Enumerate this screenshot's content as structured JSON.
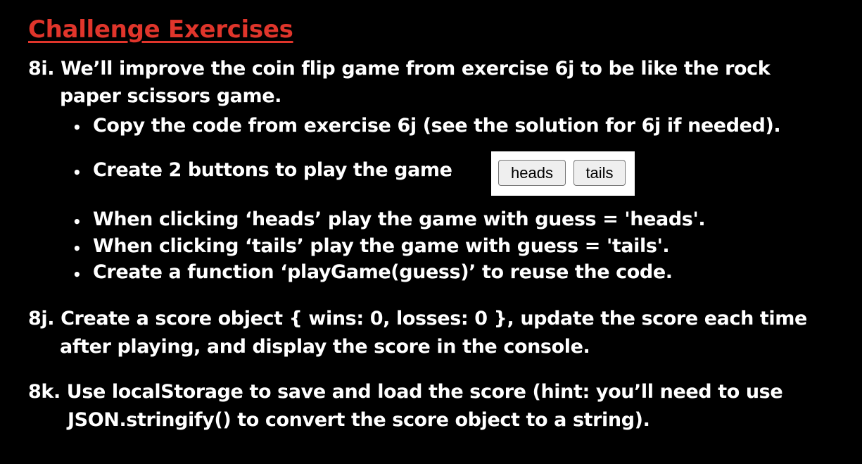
{
  "title": "Challenge Exercises",
  "ex_8i": {
    "line1": "8i. We’ll improve the coin flip game from exercise 6j to be like the rock",
    "line2": "paper scissors game.",
    "bullets": [
      "Copy the code from exercise 6j (see the solution for 6j if needed).",
      "Create 2 buttons to play the game",
      "When clicking ‘heads’ play the game with guess = 'heads'.",
      "When clicking ‘tails’ play the game with guess = 'tails'.",
      "Create a function ‘playGame(guess)’ to reuse the code."
    ],
    "bullet_symbol": "•",
    "demo_buttons": {
      "heads": "heads",
      "tails": "tails"
    }
  },
  "ex_8j": {
    "line1": "8j. Create a score object { wins: 0, losses: 0 }, update the score each time",
    "line2": "after playing, and display the score in the console."
  },
  "ex_8k": {
    "line1": "8k. Use localStorage to save and load the score (hint: you’ll need to use",
    "line2": "JSON.stringify() to convert the score object to a string)."
  },
  "colors": {
    "background": "#000000",
    "title": "#e0352b",
    "text": "#ffffff"
  }
}
